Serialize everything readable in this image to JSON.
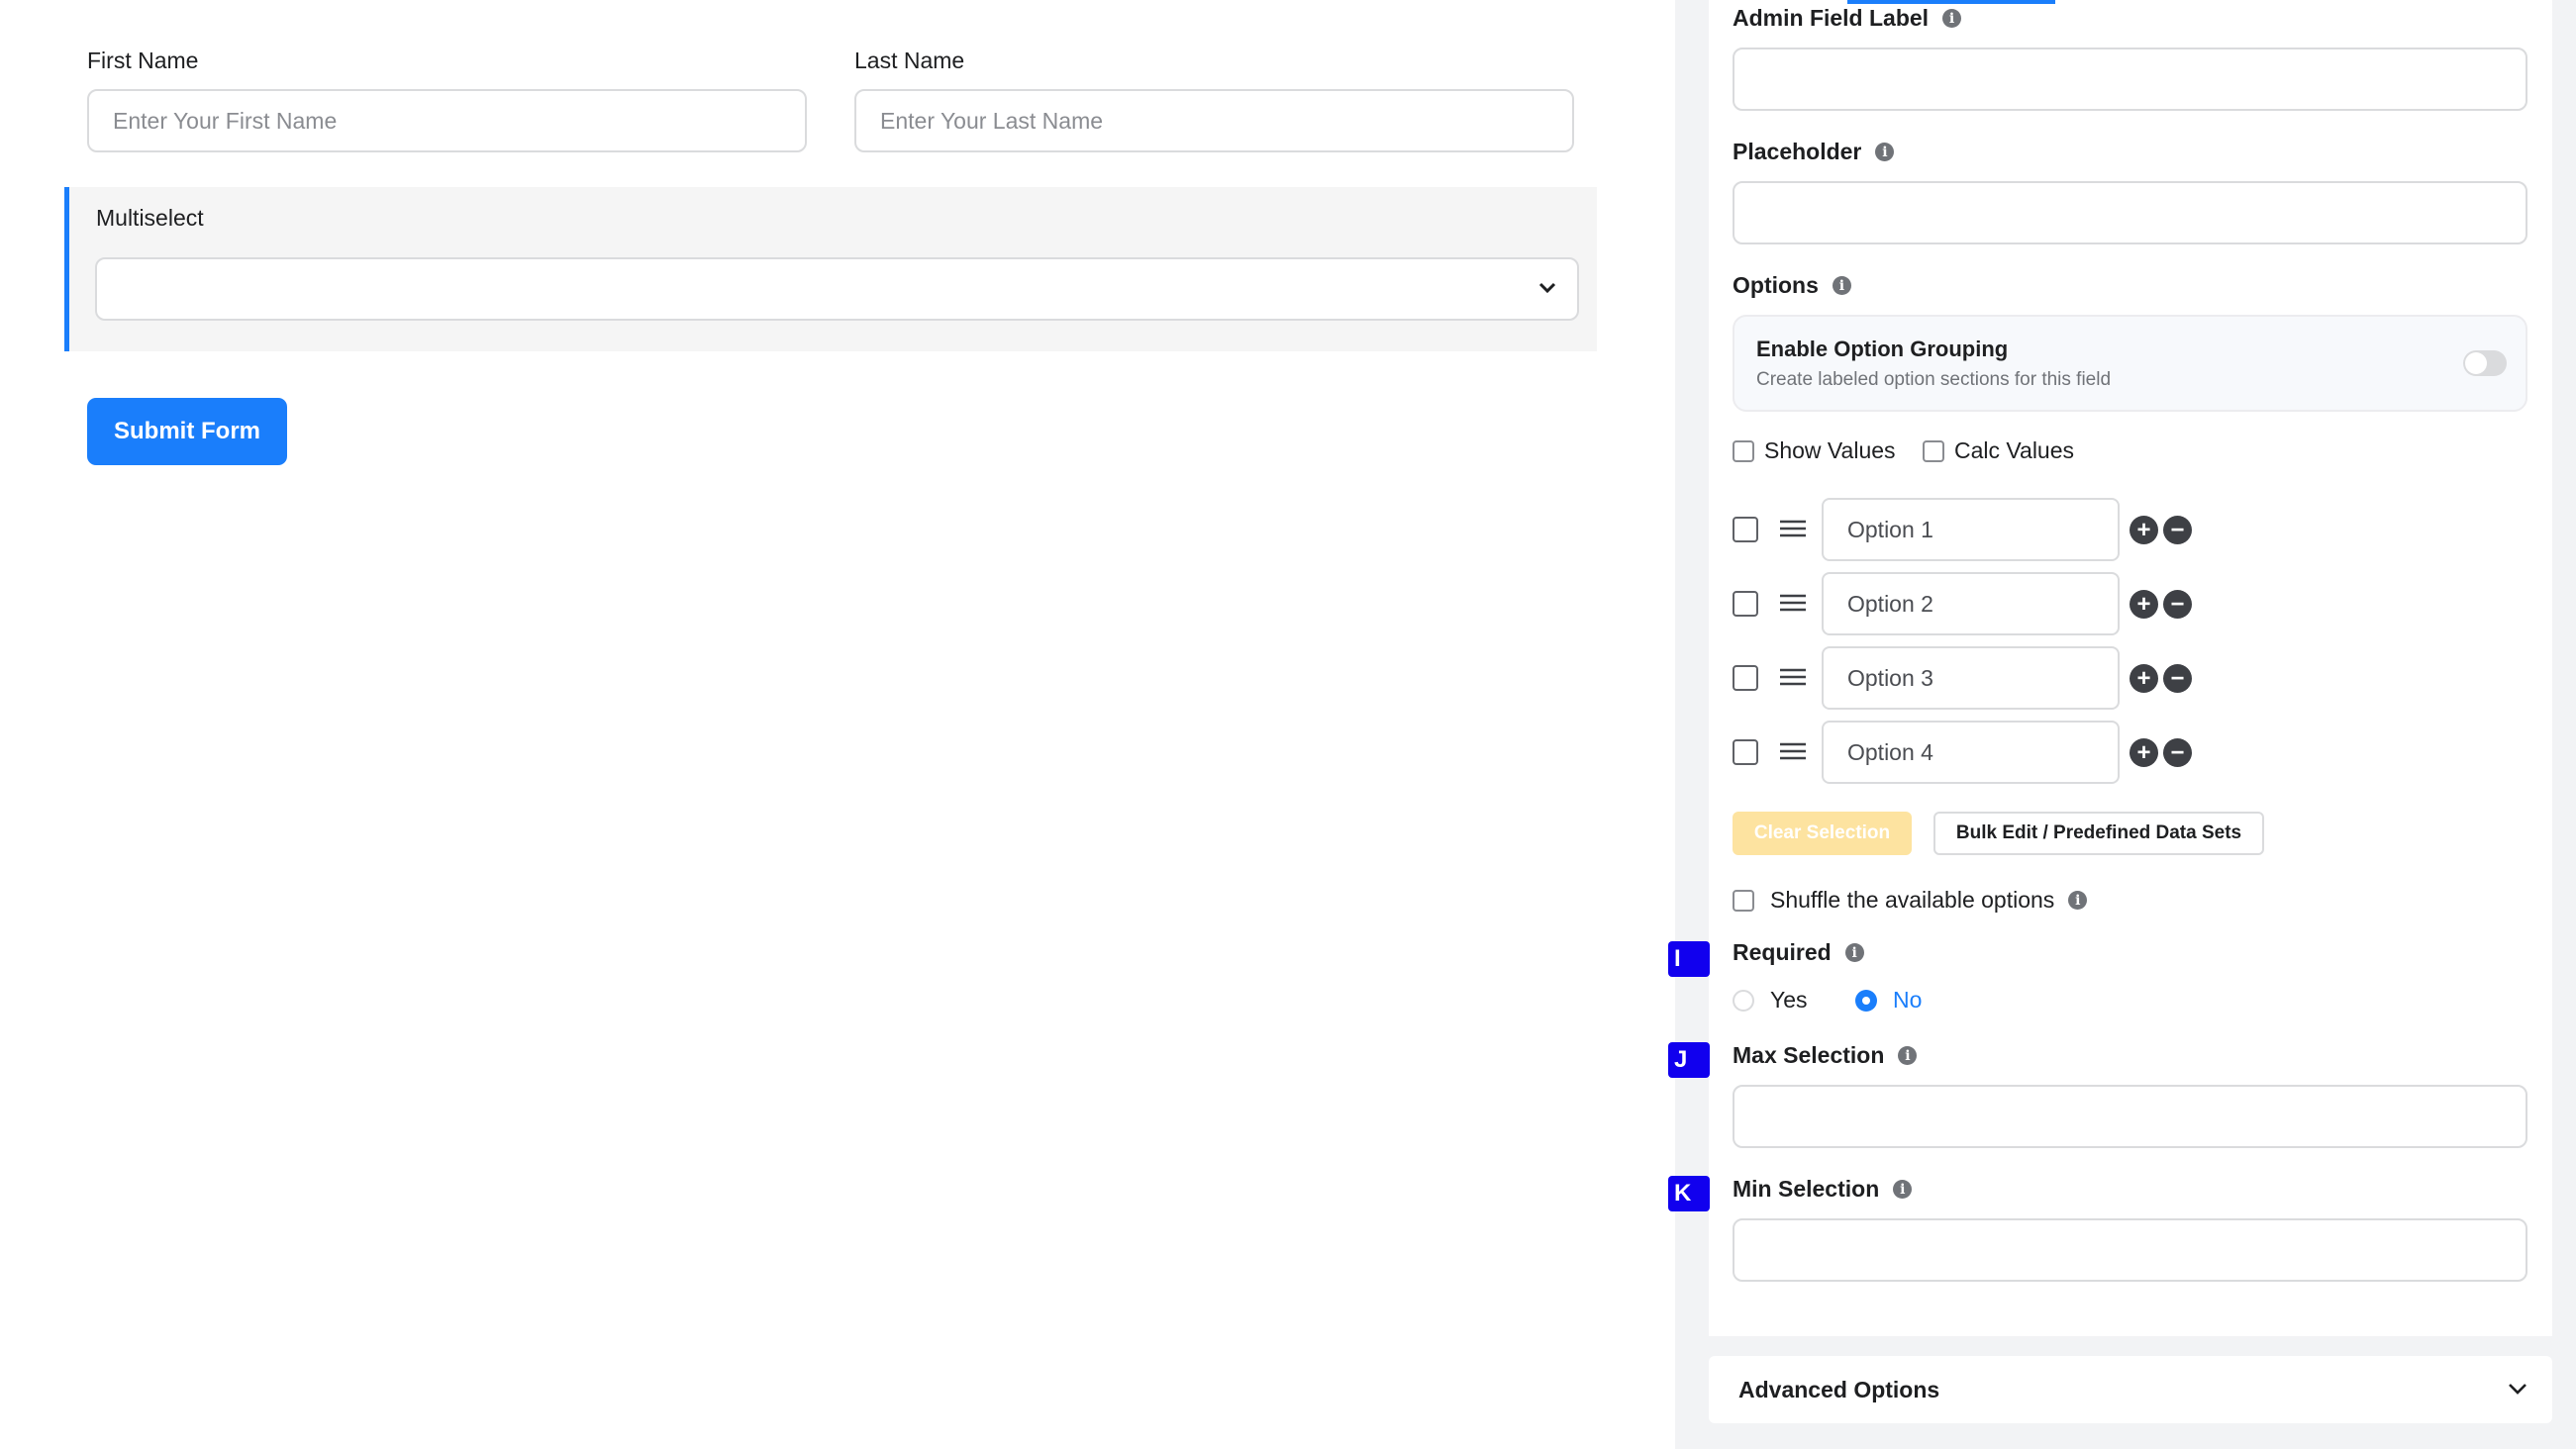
{
  "form": {
    "first_name": {
      "label": "First Name",
      "placeholder": "Enter Your First Name"
    },
    "last_name": {
      "label": "Last Name",
      "placeholder": "Enter Your Last Name"
    },
    "multiselect": {
      "label": "Multiselect"
    },
    "submit_label": "Submit Form"
  },
  "settings": {
    "admin_field_label": "Admin Field Label",
    "placeholder_label": "Placeholder",
    "options_label": "Options",
    "grouping": {
      "title": "Enable Option Grouping",
      "description": "Create labeled option sections for this field",
      "enabled": false
    },
    "show_values": "Show Values",
    "calc_values": "Calc Values",
    "options": [
      "Option 1",
      "Option 2",
      "Option 3",
      "Option 4"
    ],
    "clear_selection": "Clear Selection",
    "bulk_edit": "Bulk Edit / Predefined Data Sets",
    "shuffle": "Shuffle the available options",
    "required": {
      "label": "Required",
      "yes": "Yes",
      "no": "No",
      "selected": "No"
    },
    "max_selection": "Max Selection",
    "min_selection": "Min Selection",
    "advanced_options": "Advanced Options"
  },
  "markers": [
    "I",
    "J",
    "K"
  ],
  "colors": {
    "primary": "#1a7efb",
    "marker": "#1100ee",
    "clear_button": "#fde3a0"
  }
}
